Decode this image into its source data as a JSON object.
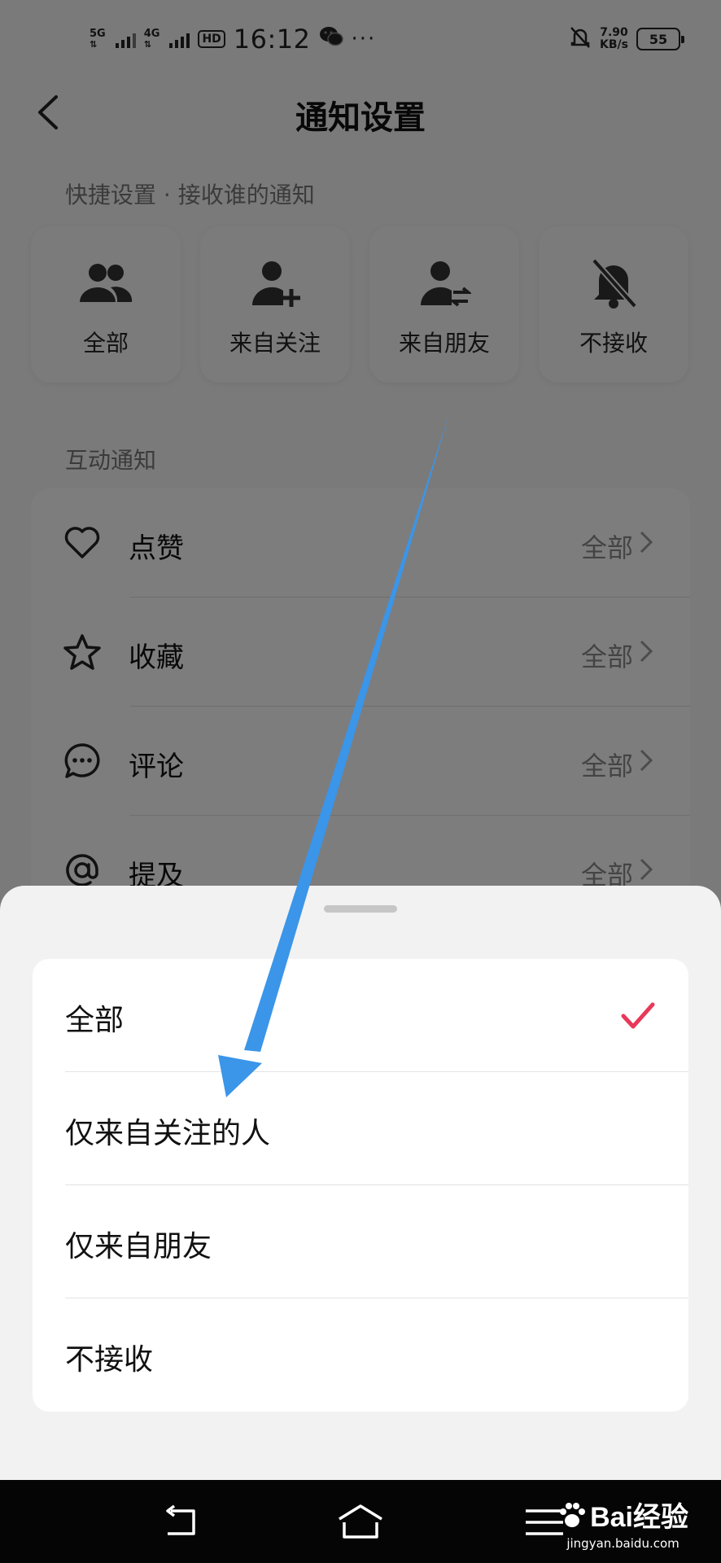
{
  "status_bar": {
    "signal1": "5G",
    "signal2": "4G",
    "hd": "HD",
    "time": "16:12",
    "speed_value": "7.90",
    "speed_unit": "KB/s",
    "battery": "55"
  },
  "header": {
    "title": "通知设置"
  },
  "quick": {
    "section_label": "快捷设置 · 接收谁的通知",
    "items": [
      {
        "label": "全部",
        "icon": "group-icon"
      },
      {
        "label": "来自关注",
        "icon": "person-add-icon"
      },
      {
        "label": "来自朋友",
        "icon": "person-swap-icon"
      },
      {
        "label": "不接收",
        "icon": "bell-off-icon"
      }
    ]
  },
  "interaction": {
    "section_label": "互动通知",
    "rows": [
      {
        "label": "点赞",
        "value": "全部",
        "icon": "heart-icon"
      },
      {
        "label": "收藏",
        "value": "全部",
        "icon": "star-icon"
      },
      {
        "label": "评论",
        "value": "全部",
        "icon": "comment-icon"
      },
      {
        "label": "提及",
        "value": "全部",
        "icon": "at-icon"
      }
    ]
  },
  "sheet": {
    "options": [
      {
        "label": "全部",
        "selected": true
      },
      {
        "label": "仅来自关注的人",
        "selected": false
      },
      {
        "label": "仅来自朋友",
        "selected": false
      },
      {
        "label": "不接收",
        "selected": false
      }
    ],
    "check_color": "#e8395a"
  },
  "watermark": {
    "brand": "Bai经验",
    "url": "jingyan.baidu.com"
  },
  "colors": {
    "arrow": "#3b95e8",
    "overlay": "#000000"
  }
}
